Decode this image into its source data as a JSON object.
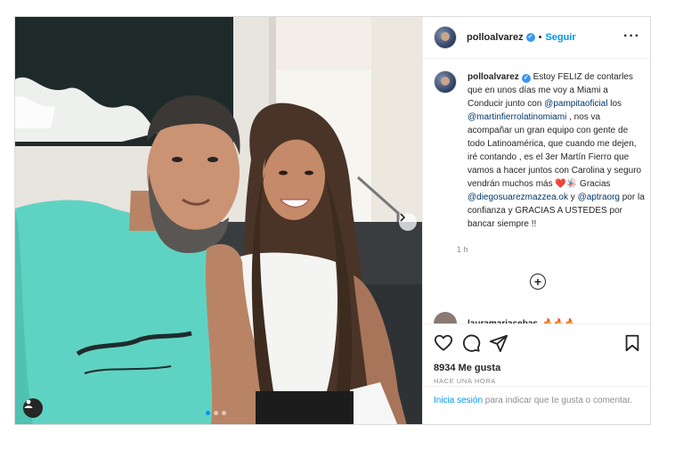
{
  "post": {
    "author": {
      "username": "polloalvarez",
      "verified_icon": "verified-badge-icon",
      "separator": "•",
      "follow_label": "Seguir"
    },
    "more_icon": "more-options-icon",
    "caption": {
      "username": "polloalvarez",
      "segments": [
        {
          "type": "text",
          "value": " Estoy FELIZ de contarles que en unos días me voy a Miami a Conducir junto con "
        },
        {
          "type": "mention",
          "value": "@pampitaoficial"
        },
        {
          "type": "text",
          "value": " los "
        },
        {
          "type": "mention",
          "value": "@martinfierrolatinomiami"
        },
        {
          "type": "text",
          "value": " , nos va acompañar un gran equipo con gente de todo Latinoamérica, que cuando me dejen, iré contando , es el 3er Martín Fierro que vamos a hacer juntos con Carolina y seguro vendrán muchos más ❤️🪅 Gracias "
        },
        {
          "type": "mention",
          "value": "@diegosuarezmazzea.ok"
        },
        {
          "type": "text",
          "value": " y "
        },
        {
          "type": "mention",
          "value": "@aptraorg"
        },
        {
          "type": "text",
          "value": " por la confianza y GRACIAS A USTEDES por bancar siempre !!"
        }
      ],
      "time": "1 h"
    },
    "load_more_label": "+",
    "next_comment": {
      "username": "lauramariasebas",
      "text": "🔥🔥🔥"
    },
    "actions": {
      "like_icon": "heart-icon",
      "comment_icon": "comment-icon",
      "share_icon": "share-icon",
      "save_icon": "bookmark-icon"
    },
    "likes": "8934 Me gusta",
    "posted_ago": "HACE UNA HORA",
    "login_prompt": {
      "link": "Inicia sesión",
      "rest": " para indicar que te gusta o comentar."
    },
    "carousel": {
      "total": 3,
      "active_index": 0
    }
  },
  "colors": {
    "accent": "#0095f6",
    "text": "#262626",
    "muted": "#8e8e8e",
    "mention": "#00376b",
    "border": "#dbdbdb"
  }
}
